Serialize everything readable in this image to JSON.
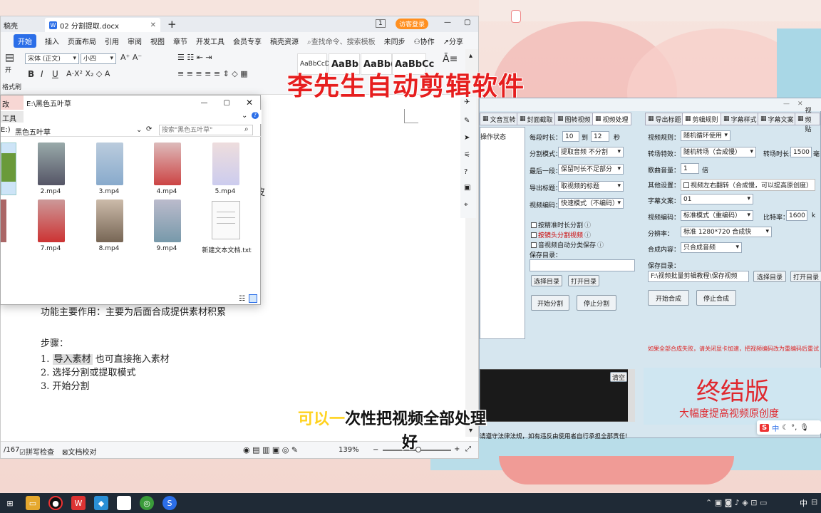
{
  "wps": {
    "left_tab": "稿壳",
    "doc_tab": "02 分割提取.docx",
    "page_badge": "1",
    "login_btn": "访客登录",
    "menu": [
      "开始",
      "插入",
      "页面布局",
      "引用",
      "审阅",
      "视图",
      "章节",
      "开发工具",
      "会员专享",
      "稿壳资源"
    ],
    "search": "查找命令、搜索模板",
    "sync": "未同步",
    "collab": "协作",
    "share": "分享",
    "paste": "开",
    "format_brush": "格式刷",
    "font_name": "宋体 (正文)",
    "font_size": "小四",
    "styles": [
      "AaBbCcDd",
      "AaBb",
      "AaBb(",
      "AaBbCc"
    ],
    "doc_lines": {
      "func": "功能主要作用：主要为后面合成提供素材积累",
      "steps": "步骤：",
      "step1_num": "1.",
      "step1_hl": "导入素材",
      "step1_rest": "也可直接拖入素材",
      "step2": "2.  选择分割或提取模式",
      "step3": "3.  开始分割",
      "side_char": "皮"
    },
    "status": {
      "page": "/167",
      "spell": "拼写检查",
      "proof": "文档校对",
      "zoom": "139%"
    }
  },
  "explorer": {
    "title": "E:\\黑色五叶草",
    "left_a": "改",
    "left_b": "工具",
    "path_prefix": "E:)",
    "path": "黑色五叶草",
    "search_ph": "搜索\"黑色五叶草\"",
    "files": [
      "2.mp4",
      "3.mp4",
      "4.mp4",
      "5.mp4",
      "7.mp4",
      "8.mp4",
      "9.mp4",
      "新建文本文档.txt"
    ]
  },
  "overlay": {
    "title": "李先生自动剪辑软件",
    "subtitle_hl": "可以一",
    "subtitle_rest": "次性把视频全部处理",
    "subtitle_line2": "好"
  },
  "tool": {
    "left_tabs": [
      "文音互转",
      "封面截取",
      "图转视频",
      "视频处理"
    ],
    "right_tabs": [
      "导出标题",
      "剪辑规则",
      "字幕样式",
      "字幕文案",
      "视频贴"
    ],
    "status_col": "操作状态",
    "seg_len_label": "每段时长：",
    "seg_from": "10",
    "seg_to_label": "到",
    "seg_to": "12",
    "seg_unit": "秒",
    "split_mode_label": "分割模式：",
    "split_mode": "提取音频 不分割",
    "last_seg_label": "最后一段：",
    "last_seg": "保留时长不足部分",
    "export_title_label": "导出标题：",
    "export_title": "取视频的标题",
    "codec_label": "视频编码：",
    "codec": "快速模式（不编码）",
    "chk1": "按精准时长分割",
    "chk2": "按镜头分割视频",
    "chk3": "音视频自动分类保存",
    "save_dir_label": "保存目录：",
    "select_dir": "选择目录",
    "open_dir": "打开目录",
    "start_split": "开始分割",
    "stop_split": "停止分割",
    "clear": "清空",
    "rule_label": "视频规则：",
    "rule": "随机循环使用",
    "trans_label": "转场特效：",
    "trans": "随机转场（合成慢）",
    "trans_len_label": "转场时长：",
    "trans_len": "1500",
    "trans_unit": "毫",
    "vol_label": "歌曲音量：",
    "vol": "1",
    "vol_unit": "倍",
    "other_label": "其他设置：",
    "flip": "视频左右翻转（合成慢，可以提高原创度）",
    "sub_label": "字幕文案：",
    "sub": "01",
    "codec2_label": "视频编码：",
    "codec2": "标准模式（重编码）",
    "bitrate_label": "比特率：",
    "bitrate": "1600",
    "bitrate_unit": "k",
    "res_label": "分辨率：",
    "res": "标准 1280*720 合成快",
    "content_label": "合成内容：",
    "content": "只合成音频",
    "save_label": "保存目录：",
    "save_path": "F:\\视频批量剪辑教程\\保存视频",
    "select_dir2": "选择目录",
    "open_dir2": "打开目录",
    "start_merge": "开始合成",
    "stop_merge": "停止合成",
    "warn": "如果全部合成失败，请关闭显卡加速，把视频编码改为重编码后重试",
    "brand_big": "终结版",
    "brand_small": "大幅度提高视频原创度",
    "law": "请遵守法律法规，如有违反由使用者自行承担全部责任!"
  },
  "tray": {
    "ime": "中",
    "ime2": "中"
  },
  "colors": {
    "accent_blue": "#2b6ee8",
    "overlay_red": "#e61e1e",
    "brand_red": "#e0282e",
    "tool_bg": "#d6e6ef"
  }
}
